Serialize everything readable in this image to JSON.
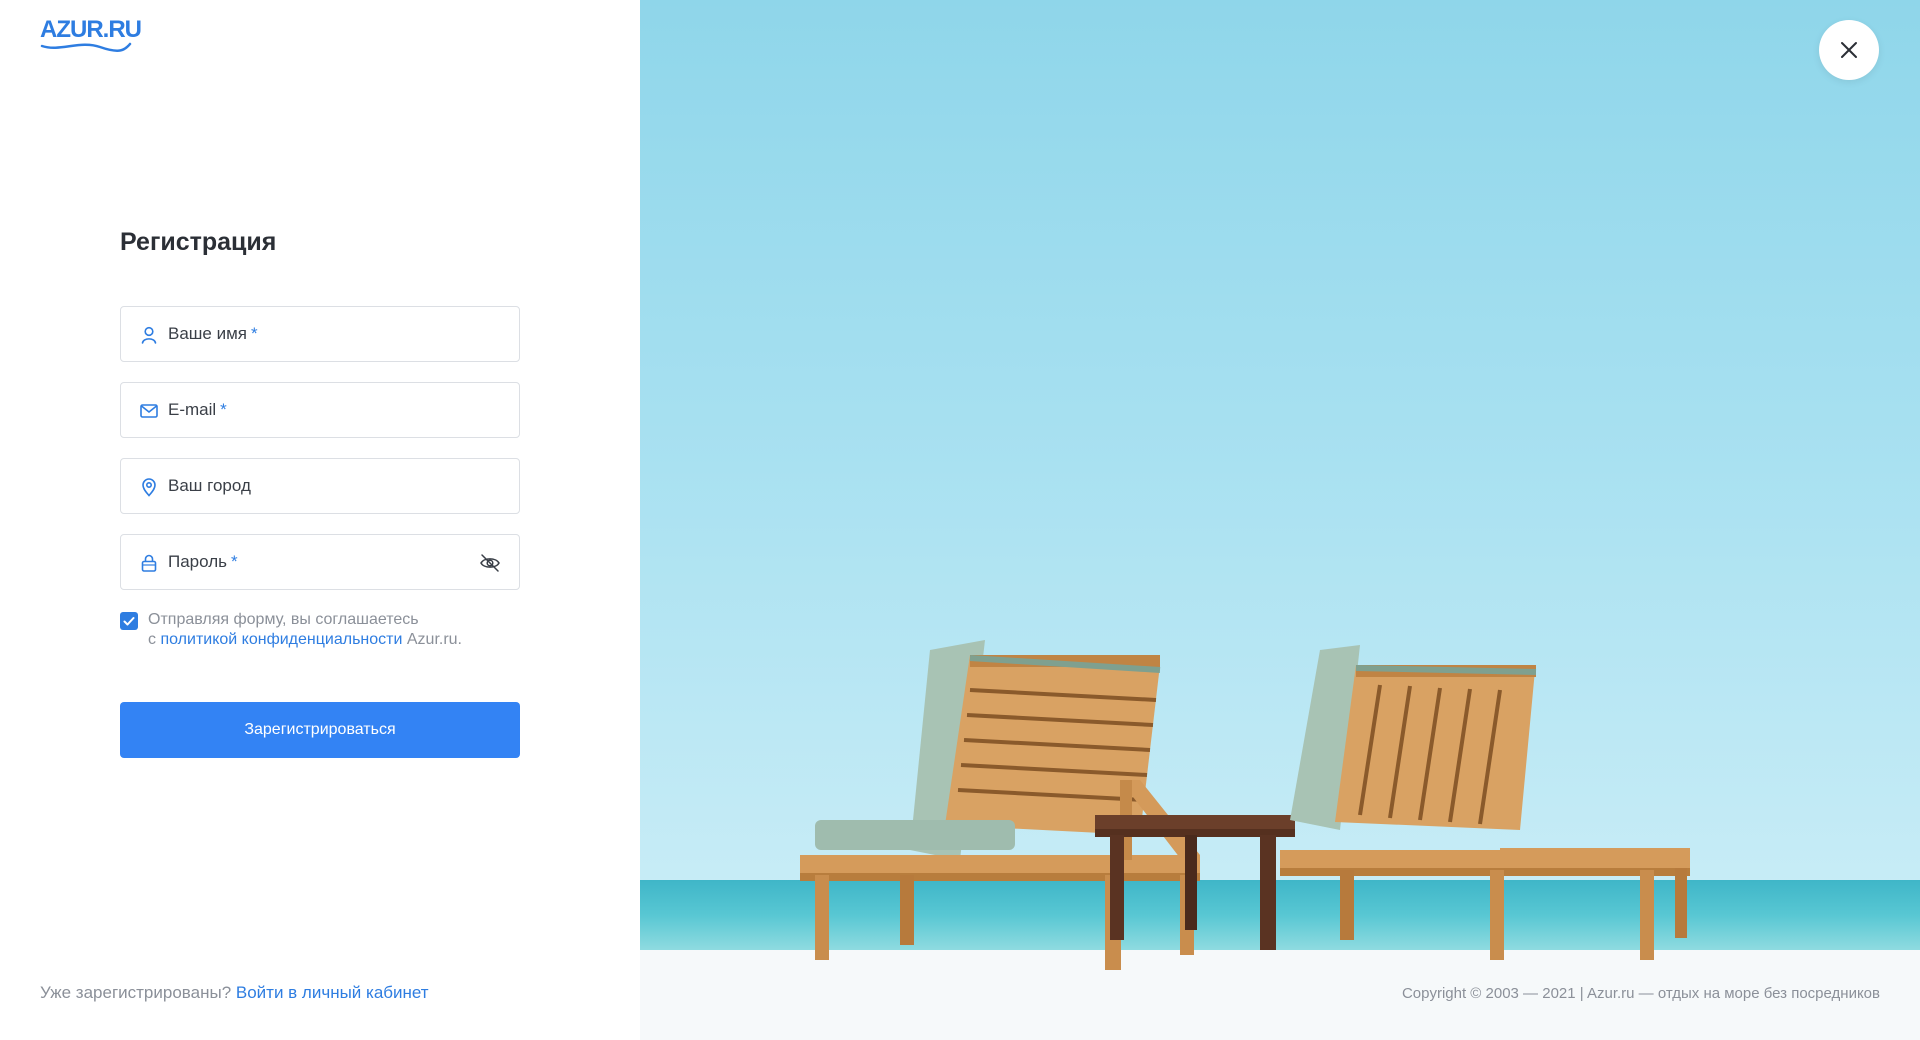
{
  "logo": {
    "text": "AZUR.RU"
  },
  "form": {
    "title": "Регистрация",
    "fields": [
      {
        "label": "Ваше имя",
        "required": "*",
        "icon": "user-icon"
      },
      {
        "label": "E-mail",
        "required": "*",
        "icon": "mail-icon"
      },
      {
        "label": "Ваш город",
        "required": "",
        "icon": "location-pin-icon"
      },
      {
        "label": "Пароль",
        "required": "*",
        "icon": "lock-icon",
        "toggle_icon": "eye-off-icon"
      }
    ],
    "consent": {
      "checked": true,
      "text_before": "Отправляя форму, вы соглашаетесь",
      "text_prefix": "с ",
      "link": "политикой конфиденциальности",
      "text_after": " Azur.ru."
    },
    "submit_label": "Зарегистрироваться"
  },
  "footer": {
    "question": "Уже зарегистрированы? ",
    "login_link": "Войти в личный кабинет",
    "copyright": "Copyright © 2003 — 2021 | Azur.ru — отдых на море без посредников"
  },
  "colors": {
    "accent": "#2e7de1",
    "button": "#3383f4",
    "muted": "#8b9099"
  },
  "icons": {
    "close": "close-icon"
  }
}
